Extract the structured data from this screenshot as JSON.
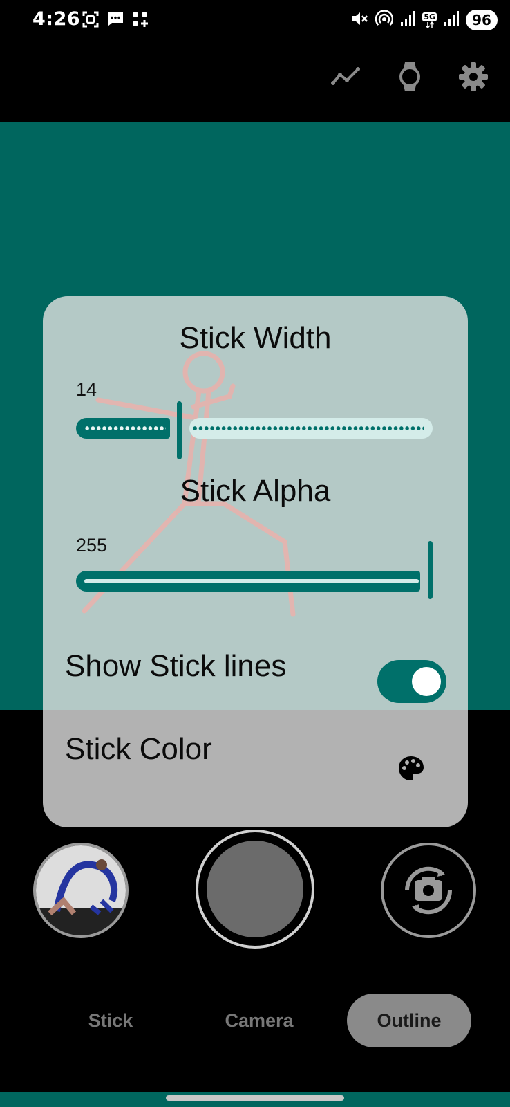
{
  "status_bar": {
    "time": "4:26",
    "left_icons": [
      "screenshot-icon",
      "message-icon",
      "app-icon"
    ],
    "right_icons": [
      "mute-icon",
      "hotspot-icon",
      "signal-icon",
      "signal-5g-icon",
      "signal-icon"
    ],
    "network_badge": "5G",
    "battery": "96"
  },
  "top_bar": {
    "actions": [
      "chart-line-icon",
      "watch-icon",
      "gear-icon"
    ]
  },
  "settings_panel": {
    "stick_width": {
      "title": "Stick Width",
      "value_label": "14",
      "value": 14
    },
    "stick_alpha": {
      "title": "Stick Alpha",
      "value_label": "255",
      "value": 255
    },
    "show_stick_lines": {
      "label": "Show Stick lines",
      "enabled": true
    },
    "stick_color": {
      "label": "Stick Color",
      "icon": "palette-icon"
    }
  },
  "camera_controls": {
    "gallery_icon": "gallery-thumbnail",
    "shutter_icon": "shutter-button",
    "flip_icon": "camera-flip-icon"
  },
  "mode_tabs": [
    {
      "label": "Stick",
      "active": false
    },
    {
      "label": "Camera",
      "active": false
    },
    {
      "label": "Outline",
      "active": true
    }
  ],
  "colors": {
    "accent": "#00706a",
    "preview_bg": "#00665e",
    "panel_bg": "#b4c9c6",
    "track_inactive": "#d4ece9"
  }
}
